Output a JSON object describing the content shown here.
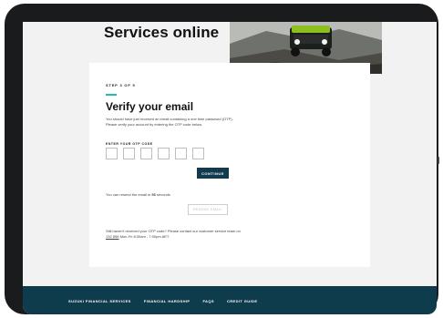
{
  "hero": {
    "title": "Services online"
  },
  "form": {
    "step_label": "STEP 3 OF 5",
    "title": "Verify your email",
    "intro": "You should have just received an email containing a one time password (OTP). Please verify your account by entering the OTP code below.",
    "otp_label": "ENTER YOUR OTP CODE",
    "otp_digits": [
      "",
      "",
      "",
      "",
      "",
      ""
    ],
    "continue_label": "CONTINUE",
    "resend_prefix": "You can resend the email in ",
    "resend_seconds": "56",
    "resend_suffix": " seconds",
    "resend_label": "RESEND EMAIL",
    "help_prefix": "Still haven't received your OTP code? Please contact our customer service team on ",
    "help_phone": "132 858",
    "help_suffix": " Mon-Fri 8:30am - 7:00pm AET."
  },
  "footer": {
    "links": [
      "SUZUKI FINANCIAL SERVICES",
      "FINANCIAL HARDSHIP",
      "FAQS",
      "CREDIT GUIDE"
    ]
  },
  "colors": {
    "accent": "#2ab9b1",
    "primary_button": "#123a4f",
    "footer_bg": "#0f3c4c"
  }
}
